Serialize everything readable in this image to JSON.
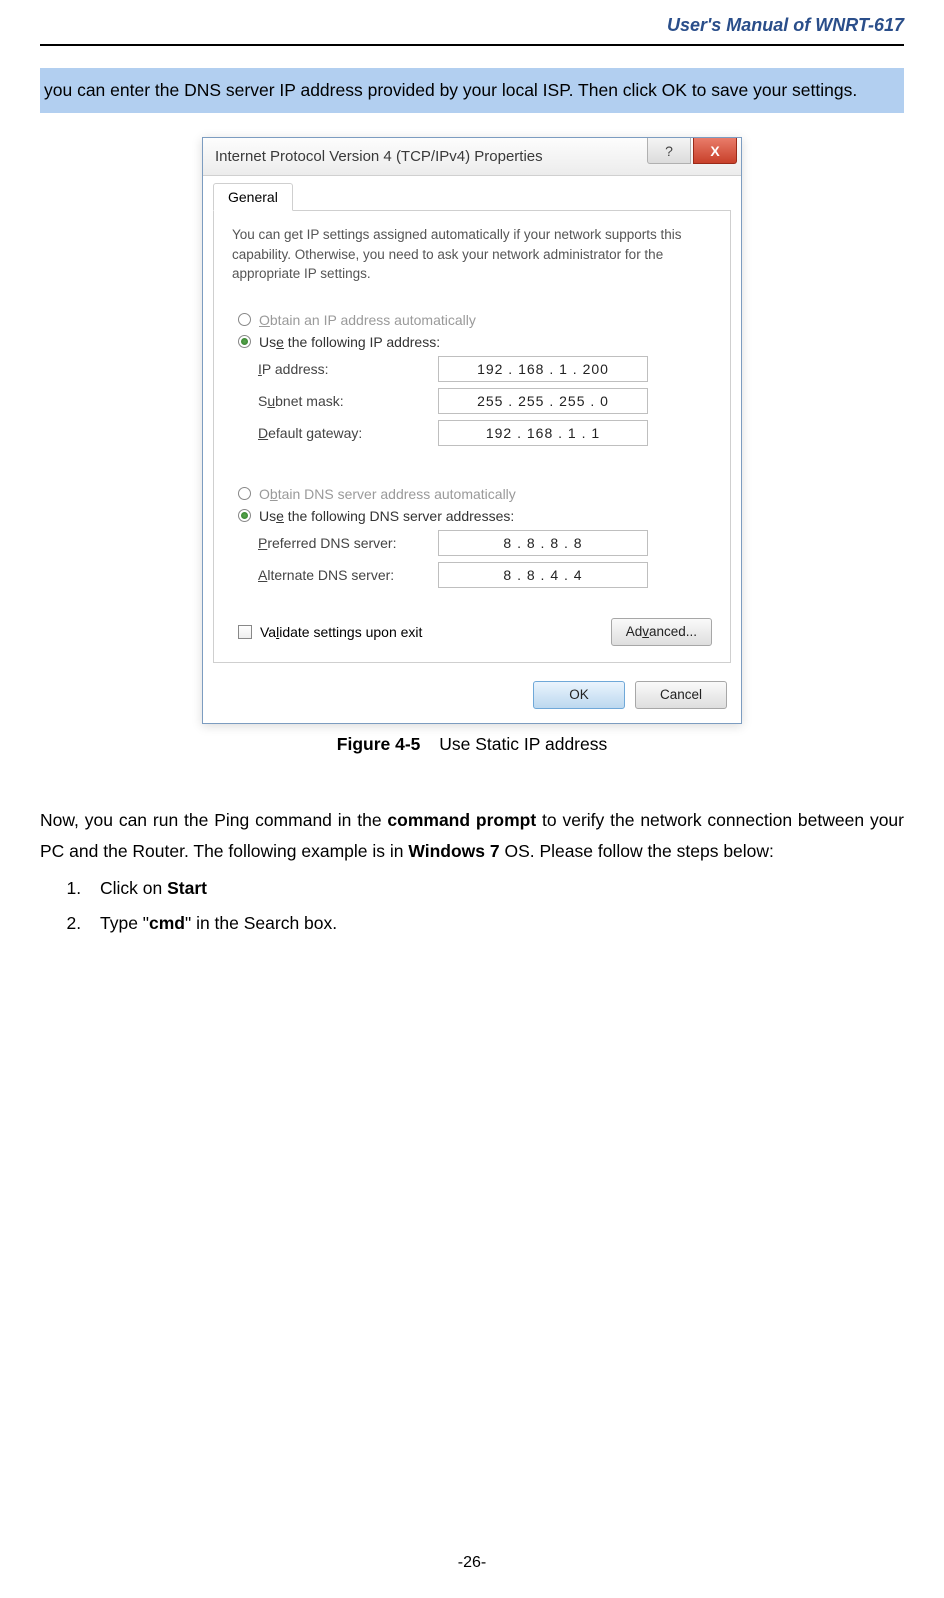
{
  "header": {
    "title": "User's Manual of WNRT-617"
  },
  "highlight": "you can enter the DNS server IP address provided by your local ISP. Then click OK to save your settings.",
  "dialog": {
    "title": "Internet Protocol Version 4 (TCP/IPv4) Properties",
    "help_glyph": "?",
    "close_glyph": "X",
    "tab": "General",
    "intro": "You can get IP settings assigned automatically if your network supports this capability. Otherwise, you need to ask your network administrator for the appropriate IP settings.",
    "ip_section": {
      "radio_auto": "Obtain an IP address automatically",
      "radio_manual": "Use the following IP address:",
      "ip_label": "IP address:",
      "ip_value": "192 . 168 .  1   . 200",
      "subnet_label": "Subnet mask:",
      "subnet_value": "255 . 255 . 255 .  0",
      "gateway_label": "Default gateway:",
      "gateway_value": "192 . 168 .  1   .  1"
    },
    "dns_section": {
      "radio_auto": "Obtain DNS server address automatically",
      "radio_manual": "Use the following DNS server addresses:",
      "pref_label": "Preferred DNS server:",
      "pref_value": "8  .  8  .  8  .  8",
      "alt_label": "Alternate DNS server:",
      "alt_value": "8  .  8  .  4  .  4"
    },
    "validate_label": "Validate settings upon exit",
    "advanced_btn": "Advanced...",
    "ok_btn": "OK",
    "cancel_btn": "Cancel"
  },
  "figure": {
    "number": "Figure 4-5",
    "caption": "Use Static IP address"
  },
  "para": {
    "pre": "Now, you can run the Ping command in the ",
    "bold1": "command prompt",
    "mid": " to verify the network connection between your PC and the Router. The following example is in ",
    "bold2": "Windows 7",
    "post": " OS. Please follow the steps below:"
  },
  "steps": {
    "s1_pre": "Click on ",
    "s1_bold": "Start",
    "s2_pre": "Type \"",
    "s2_bold": "cmd",
    "s2_post": "\" in the Search box."
  },
  "page_number": "-26-"
}
